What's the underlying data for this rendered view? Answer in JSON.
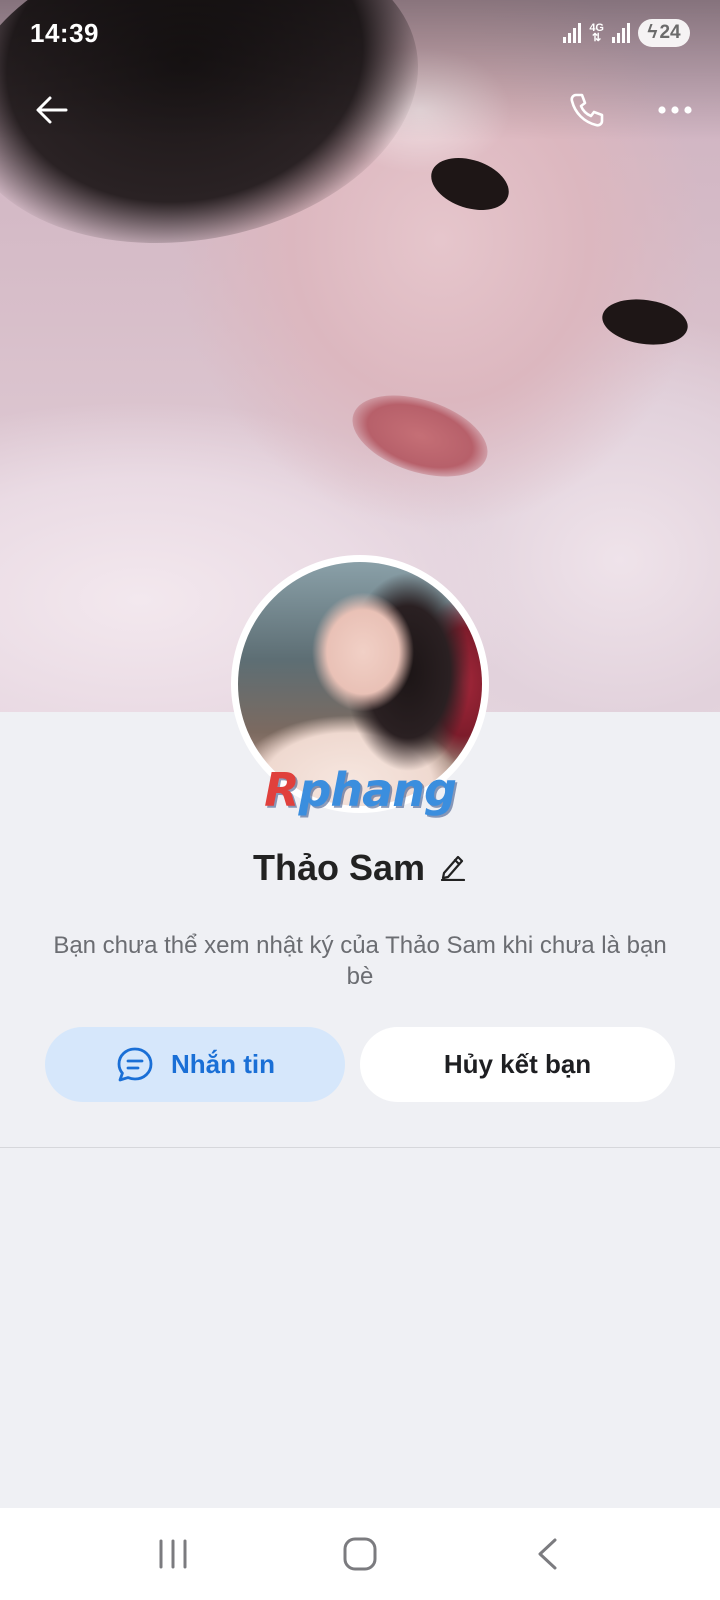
{
  "status_bar": {
    "time": "14:39",
    "network": "4G",
    "battery": "24"
  },
  "header": {
    "back_icon": "back-arrow-icon",
    "call_icon": "phone-icon",
    "more_icon": "more-dots-icon"
  },
  "profile": {
    "watermark_first": "R",
    "watermark_rest": "phang",
    "name": "Thảo Sam",
    "notice": "Bạn chưa thể xem nhật ký của Thảo Sam khi chưa là bạn bè"
  },
  "actions": {
    "message_label": "Nhắn tin",
    "unfriend_label": "Hủy kết bạn"
  },
  "colors": {
    "accent": "#1a6fd6",
    "accent_bg": "#d6e7fb",
    "page_bg": "#eff0f4"
  },
  "nav": {
    "recent_icon": "recent-apps-icon",
    "home_icon": "home-icon",
    "back_icon": "nav-back-icon"
  }
}
